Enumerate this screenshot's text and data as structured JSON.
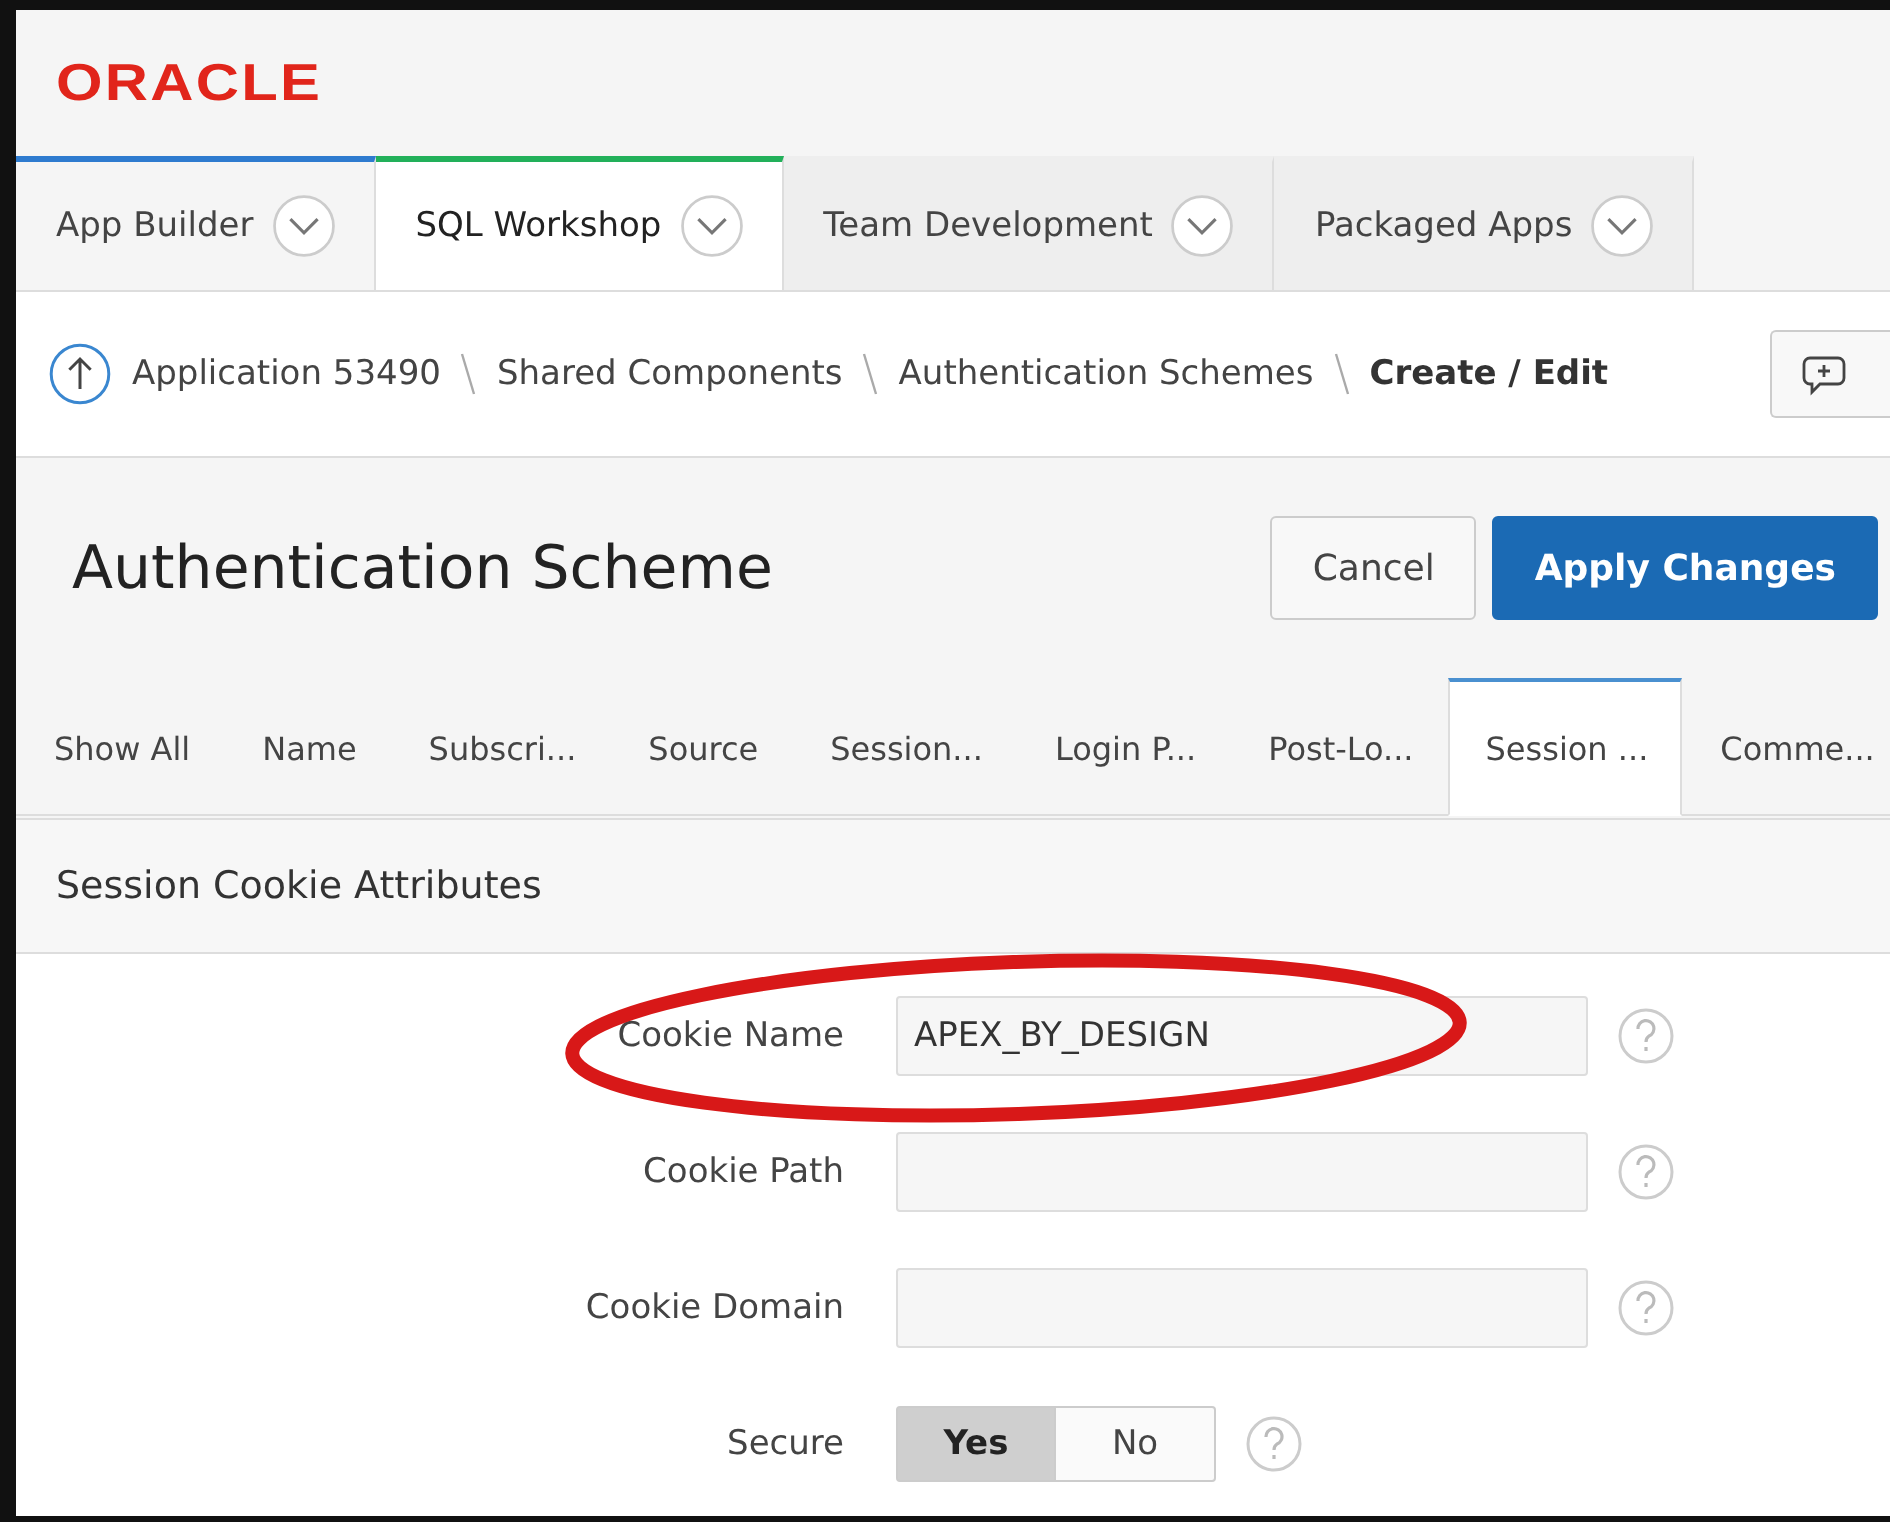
{
  "logo": "ORACLE",
  "nav_tabs": [
    {
      "label": "App Builder",
      "selected": false,
      "color": "#2e7bcf"
    },
    {
      "label": "SQL Workshop",
      "selected": true,
      "color": "#22b05a"
    },
    {
      "label": "Team Development",
      "selected": false
    },
    {
      "label": "Packaged Apps",
      "selected": false
    }
  ],
  "breadcrumb": [
    {
      "label": "Application 53490",
      "current": false
    },
    {
      "label": "Shared Components",
      "current": false
    },
    {
      "label": "Authentication Schemes",
      "current": false
    },
    {
      "label": "Create / Edit",
      "current": true
    }
  ],
  "page_title": "Authentication Scheme",
  "buttons": [
    {
      "label": "Cancel",
      "kind": "secondary"
    },
    {
      "label": "Apply Changes",
      "kind": "primary"
    }
  ],
  "region_tabs": [
    {
      "label": "Show All",
      "selected": false
    },
    {
      "label": "Name",
      "selected": false
    },
    {
      "label": "Subscri...",
      "selected": false
    },
    {
      "label": "Source",
      "selected": false
    },
    {
      "label": "Session...",
      "selected": false
    },
    {
      "label": "Login P...",
      "selected": false
    },
    {
      "label": "Post-Lo...",
      "selected": false
    },
    {
      "label": "Session ...",
      "selected": true
    },
    {
      "label": "Comme...",
      "selected": false
    }
  ],
  "section": {
    "title": "Session Cookie Attributes",
    "fields": [
      {
        "label": "Cookie Name",
        "kind": "text",
        "value": "APEX_BY_DESIGN",
        "highlighted": true
      },
      {
        "label": "Cookie Path",
        "kind": "text",
        "highlighted": false
      },
      {
        "label": "Cookie Domain",
        "kind": "text",
        "highlighted": false
      },
      {
        "label": "Secure",
        "kind": "toggle",
        "options": [
          {
            "label": "Yes",
            "selected": true
          },
          {
            "label": "No",
            "selected": false
          }
        ],
        "highlighted": false
      }
    ]
  }
}
